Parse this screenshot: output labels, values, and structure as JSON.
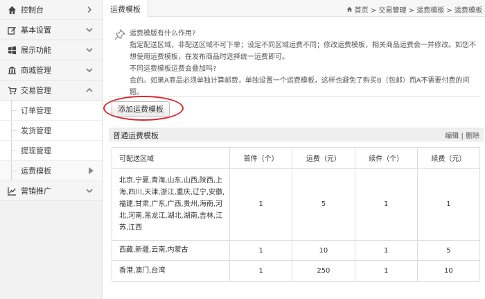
{
  "sidebar": {
    "items": [
      {
        "label": "控制台",
        "icon": "dashboard-icon"
      },
      {
        "label": "基本设置",
        "icon": "edit-icon"
      },
      {
        "label": "展示功能",
        "icon": "windows-icon"
      },
      {
        "label": "商城管理",
        "icon": "bank-icon"
      },
      {
        "label": "交易管理",
        "icon": "cart-icon"
      }
    ],
    "subitems": [
      {
        "label": "订单管理"
      },
      {
        "label": "发货管理"
      },
      {
        "label": "提现管理"
      },
      {
        "label": "运费模板"
      }
    ],
    "last": {
      "label": "营销推广",
      "icon": "chart-icon"
    }
  },
  "topbar": {
    "tab": "运费模板",
    "breadcrumb": "首页 > 交易管理 > 运费模板 > 运费模板"
  },
  "help": {
    "q1": "运费模版有什么作用?",
    "a1": "指定配送区域，非配送区域不可下单；设定不同区域运费不同；修改运费模板，相关商品运费会一并修改。如您不想使用运费模板，在发布商品时选择统一运费即可。",
    "q2": "不同运费模板运费会叠加吗?",
    "a2": "会的。如果A商品必须单独计算邮费，单独设置一个运费模板，这样也避免了购买B（包邮）而A不需要付费的问题。"
  },
  "add_button": "添加运费模板",
  "template": {
    "title": "普通运费模板",
    "edit": "编辑",
    "sep": " | ",
    "delete": "删除",
    "headers": [
      "可配送区域",
      "首件（个）",
      "运费（元）",
      "续件（个）",
      "续费（元）"
    ],
    "rows": [
      {
        "region": "北京,宁夏,青海,山东,山西,陕西,上海,四川,天津,浙江,重庆,辽宁,安徽,福建,甘肃,广东,广西,贵州,海南,河北,河南,黑龙江,湖北,湖南,吉林,江苏,江西",
        "first": "1",
        "fee": "5",
        "extra": "1",
        "extra_fee": "1"
      },
      {
        "region": "西藏,新疆,云南,内蒙古",
        "first": "1",
        "fee": "10",
        "extra": "1",
        "extra_fee": "5"
      },
      {
        "region": "香港,澳门,台湾",
        "first": "1",
        "fee": "250",
        "extra": "1",
        "extra_fee": "10"
      }
    ]
  },
  "colors": {
    "highlight_circle": "#d9262b"
  }
}
